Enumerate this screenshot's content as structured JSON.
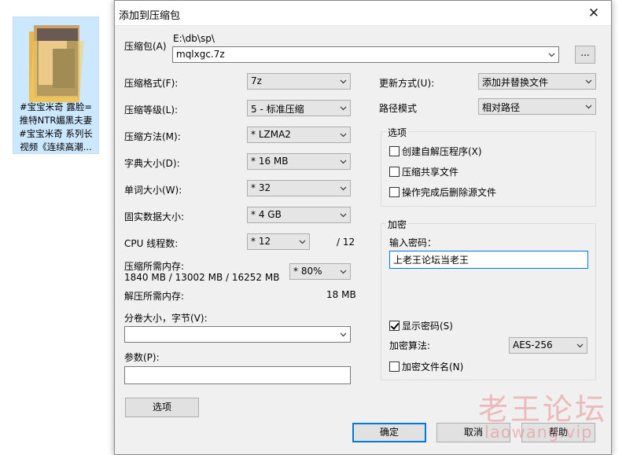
{
  "desktop": {
    "file_caption": "#宝宝米奇 露脸=\n推特NTR媚黑夫妻\n#宝宝米奇 系列长\n视频《连续高潮..."
  },
  "dialog": {
    "title": "添加到压缩包",
    "close_label": "✕",
    "archive": {
      "label": "压缩包(A)",
      "path": "E:\\db\\sp\\",
      "filename": "mqlxgc.7z",
      "browse_label": "..."
    },
    "left": {
      "format": {
        "label": "压缩格式(F):",
        "value": "7z"
      },
      "level": {
        "label": "压缩等级(L):",
        "value": "5 - 标准压缩"
      },
      "method": {
        "label": "压缩方法(M):",
        "value": "* LZMA2"
      },
      "dict": {
        "label": "字典大小(D):",
        "value": "* 16 MB"
      },
      "word": {
        "label": "单词大小(W):",
        "value": "* 32"
      },
      "solid": {
        "label": "固实数据大小:",
        "value": "* 4 GB"
      },
      "threads": {
        "label": "CPU 线程数:",
        "value": "* 12",
        "max": "/ 12"
      },
      "mem_compress": {
        "label": "压缩所需内存:",
        "detail": "1840 MB / 13002 MB / 16252 MB",
        "percent": "* 80%"
      },
      "mem_decompress": {
        "label": "解压所需内存:",
        "value": "18 MB"
      },
      "volume": {
        "label": "分卷大小，字节(V):",
        "value": ""
      },
      "params": {
        "label": "参数(P):",
        "value": ""
      },
      "options_button": "选项"
    },
    "right": {
      "update": {
        "label": "更新方式(U):",
        "value": "添加并替换文件"
      },
      "pathmode": {
        "label": "路径模式",
        "value": "相对路径"
      },
      "options_group": {
        "title": "选项",
        "sfx": "创建自解压程序(X)",
        "shared": "压缩共享文件",
        "delete": "操作完成后删除源文件"
      },
      "encrypt_group": {
        "title": "加密",
        "password_label": "输入密码：",
        "password_value": "上老王论坛当老王",
        "show_password": "显示密码(S)",
        "method_label": "加密算法:",
        "method_value": "AES-256",
        "encrypt_names": "加密文件名(N)"
      }
    },
    "buttons": {
      "ok": "确定",
      "cancel": "取消",
      "help": "帮助"
    }
  },
  "watermark": {
    "cn": "老王论坛",
    "url": "laowang.vip"
  }
}
